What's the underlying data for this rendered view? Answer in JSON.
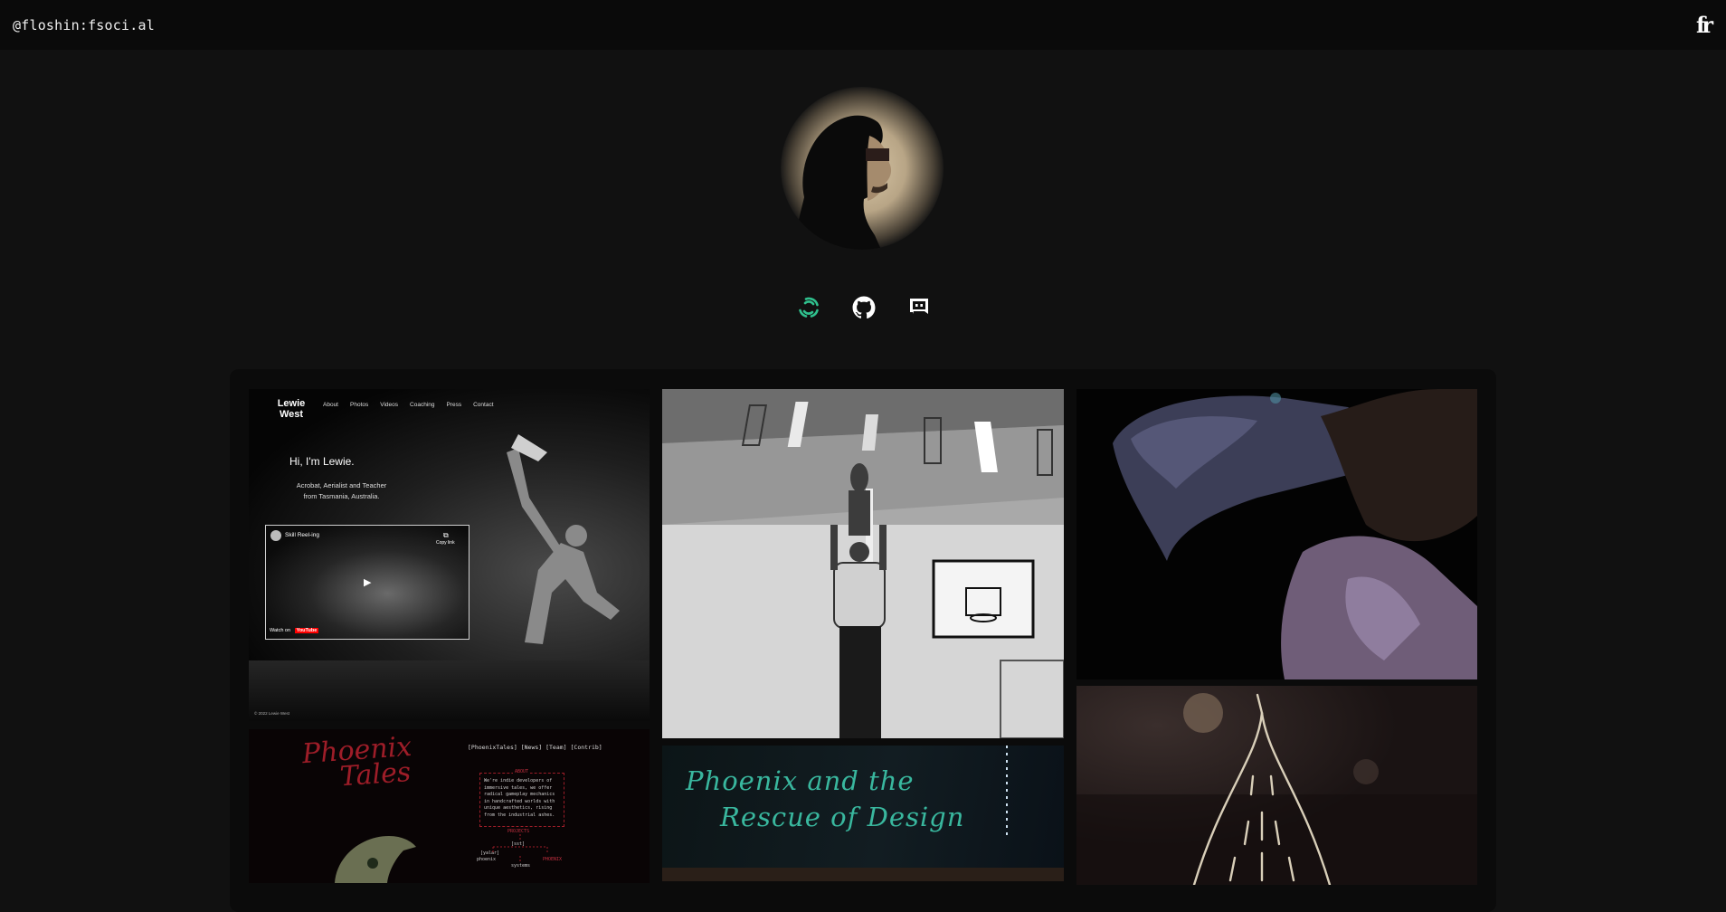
{
  "topbar": {
    "handle": "@floshin:fsoci.al",
    "logo_text": "fr",
    "logo_icon": "fr-monogram-icon"
  },
  "profile": {
    "avatar_icon": "hooded-profile-avatar"
  },
  "social": [
    {
      "icon": "element-matrix-icon",
      "color": "#2fc08d"
    },
    {
      "icon": "github-icon",
      "color": "#ffffff"
    },
    {
      "icon": "discord-icon",
      "color": "#ffffff"
    }
  ],
  "gallery": {
    "lewie": {
      "brand_line1": "Lewie",
      "brand_line2": "West",
      "nav": [
        "About",
        "Photos",
        "Videos",
        "Coaching",
        "Press",
        "Contact"
      ],
      "headline": "Hi, I'm Lewie.",
      "sub_line1": "Acrobat, Aerialist and Teacher",
      "sub_line2": "from Tasmania, Australia.",
      "video_title": "Skill Reel-ing",
      "copy_link": "Copy link",
      "watch_on": "Watch on",
      "youtube": "YouTube",
      "footer": "© 2022 Lewie West"
    },
    "phoenix_site": {
      "logo_line1": "Phoenix",
      "logo_line2": "Tales",
      "menu": "[PhoenixTales] [News] [Team] [Contrib]",
      "about_heading": "ABOUT",
      "about_lines": [
        "We're indie developers of",
        "immersive tales, we offer",
        "radical gameplay mechanics",
        "in handcrafted worlds with",
        "unique aesthetics, rising",
        "from the industrial ashes."
      ],
      "projects_heading": "PROJECTS",
      "projects": [
        "[sst]",
        "[yalar]",
        "phoenix",
        "systems",
        "PHOENIX"
      ]
    },
    "rescue": {
      "line1": "Phoenix and the",
      "line2": "Rescue of Design"
    }
  }
}
